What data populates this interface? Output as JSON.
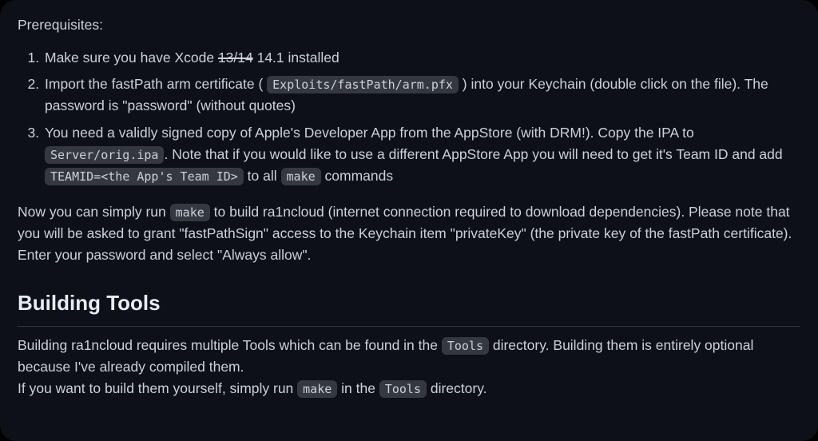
{
  "prerequisites_label": "Prerequisites:",
  "items": [
    {
      "pre": "Make sure you have Xcode ",
      "strike": "13/14",
      "post": " 14.1 installed"
    },
    {
      "pre": "Import the fastPath arm certificate ( ",
      "code1": "Exploits/fastPath/arm.pfx",
      "post": " ) into your Keychain (double click on the file). The password is \"password\" (without quotes)"
    },
    {
      "pre": "You need a validly signed copy of Apple's Developer App from the AppStore (with DRM!). Copy the IPA to ",
      "code1": "Server/orig.ipa",
      "mid1": ". Note that if you would like to use a different AppStore App you will need to get it's Team ID and add ",
      "code2": "TEAMID=<the App's Team ID>",
      "mid2": " to all ",
      "code3": "make",
      "post": " commands"
    }
  ],
  "run_para": {
    "pre": "Now you can simply run ",
    "code": "make",
    "post": " to build ra1ncloud (internet connection required to download dependencies). Please note that you will be asked to grant \"fastPathSign\" access to the Keychain item \"privateKey\" (the private key of the fastPath certificate). Enter your password and select \"Always allow\"."
  },
  "heading": "Building Tools",
  "tools_para": {
    "pre": "Building ra1ncloud requires multiple Tools which can be found in the ",
    "code1": "Tools",
    "mid1": " directory. Building them is entirely optional because I've already compiled them.",
    "br": true,
    "line2_pre": "If you want to build them yourself, simply run ",
    "code2": "make",
    "line2_mid": " in the ",
    "code3": "Tools",
    "line2_post": " directory."
  }
}
